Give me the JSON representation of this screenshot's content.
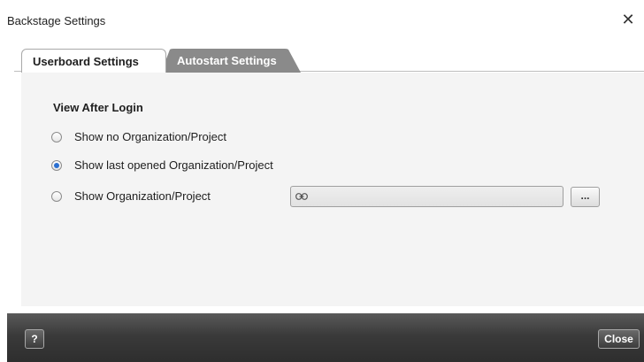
{
  "window": {
    "title": "Backstage Settings",
    "close_glyph": "✕"
  },
  "tabs": [
    {
      "label": "Userboard Settings",
      "active": true
    },
    {
      "label": "Autostart Settings",
      "active": false
    }
  ],
  "view_after_login": {
    "title": "View After Login",
    "options": [
      {
        "label": "Show no Organization/Project",
        "checked": false
      },
      {
        "label": "Show last opened Organization/Project",
        "checked": true
      },
      {
        "label": "Show Organization/Project",
        "checked": false
      }
    ],
    "path_field": {
      "value": "",
      "icon": "link-icon"
    },
    "browse_label": "..."
  },
  "footer": {
    "help_label": "?",
    "close_label": "Close"
  },
  "colors": {
    "inactive_tab": "#8a8a8a",
    "footer_bar": "#3a3a3a",
    "panel_background": "#f4f4f4",
    "radio_selected": "#2a6fd1"
  }
}
